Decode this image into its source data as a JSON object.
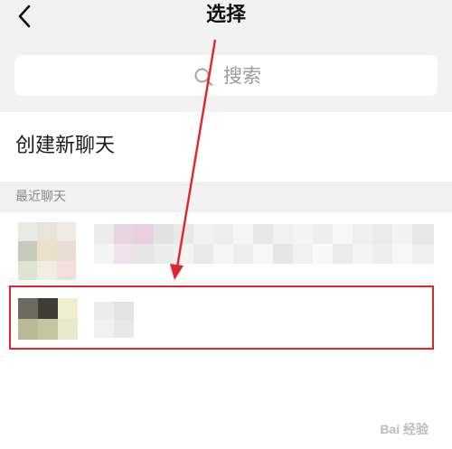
{
  "nav": {
    "title": "选择",
    "back_icon": "chevron-left-icon"
  },
  "search": {
    "placeholder": "搜索",
    "icon": "search-icon"
  },
  "create_chat": {
    "label": "创建新聊天"
  },
  "recent": {
    "header": "最近聊天"
  },
  "watermark": "Bai 经验",
  "colors": {
    "highlight": "#e0262b",
    "annotation_arrow": "#e0262b"
  }
}
